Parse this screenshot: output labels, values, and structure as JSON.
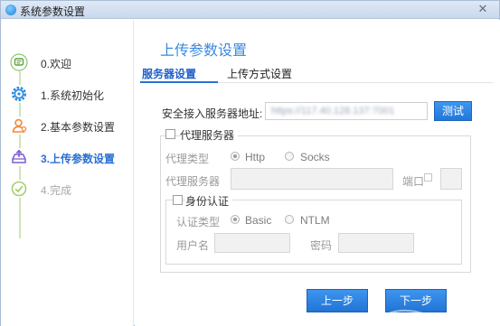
{
  "window": {
    "title": "系统参数设置",
    "close_glyph": "✕"
  },
  "steps": [
    {
      "label": "0.欢迎",
      "icon": "chat-icon",
      "state": "done"
    },
    {
      "label": "1.系统初始化",
      "icon": "gear-icon",
      "state": "done"
    },
    {
      "label": "2.基本参数设置",
      "icon": "user-icon",
      "state": "done"
    },
    {
      "label": "3.上传参数设置",
      "icon": "upload-icon",
      "state": "active"
    },
    {
      "label": "4.完成",
      "icon": "check-icon",
      "state": "disabled"
    }
  ],
  "main": {
    "title": "上传参数设置",
    "tabs": [
      {
        "label": "服务器设置",
        "active": true
      },
      {
        "label": "上传方式设置",
        "active": false
      }
    ],
    "server_label": "安全接入服务器地址:",
    "server_value": "https://117.40.128.137:7001",
    "test_button": "测试",
    "proxy": {
      "checkbox_label": "代理服务器",
      "type_label": "代理类型",
      "type_options": [
        "Http",
        "Socks"
      ],
      "type_selected": "Http",
      "server_label": "代理服务器",
      "port_label": "端口"
    },
    "auth": {
      "checkbox_label": "身份认证",
      "type_label": "认证类型",
      "type_options": [
        "Basic",
        "NTLM"
      ],
      "type_selected": "Basic",
      "user_label": "用户名",
      "password_label": "密码"
    },
    "prev_button": "上一步",
    "next_button": "下一步"
  },
  "colors": {
    "accent": "#2a6fd3",
    "title": "#3a89e0",
    "track": "#cfe5b5"
  }
}
